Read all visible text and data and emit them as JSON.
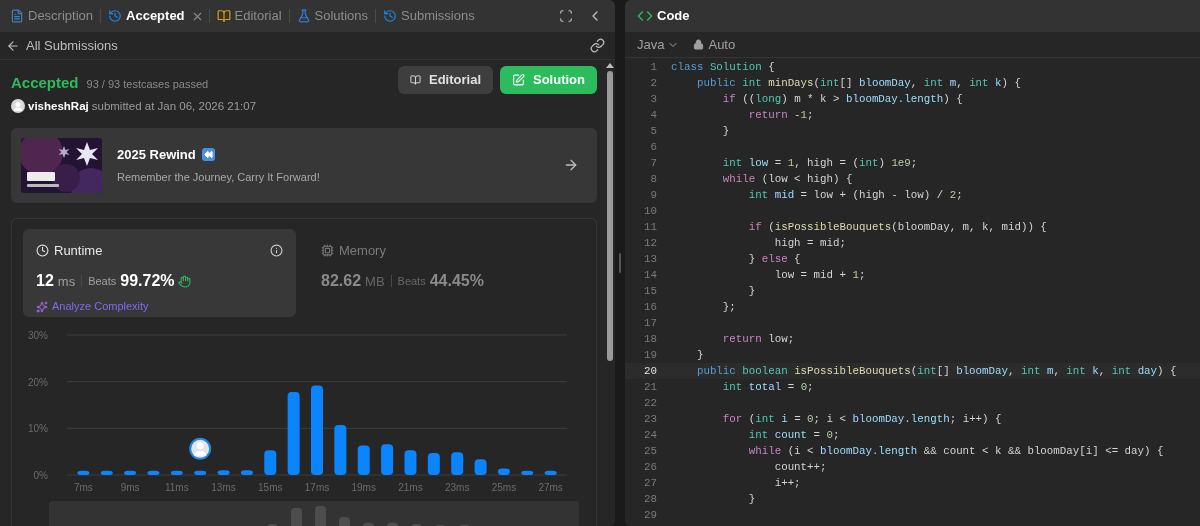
{
  "left_panel": {
    "tabs": [
      {
        "label": "Description",
        "kind": "description",
        "selected": false
      },
      {
        "label": "Accepted",
        "kind": "result",
        "selected": true,
        "closable": true
      },
      {
        "label": "Editorial",
        "kind": "editorial",
        "selected": false
      },
      {
        "label": "Solutions",
        "kind": "solutions",
        "selected": false
      },
      {
        "label": "Submissions",
        "kind": "submissions",
        "selected": false
      }
    ],
    "back_link": "All Submissions",
    "submission": {
      "status": "Accepted",
      "testcases": "93 / 93 testcases passed",
      "user": "visheshRaj",
      "submitted": "submitted at Jan 06, 2026 21:07"
    },
    "buttons": [
      {
        "label": "Editorial",
        "kind": "secondary"
      },
      {
        "label": "Solution",
        "kind": "primary"
      }
    ],
    "banner": {
      "title": "2025 Rewind",
      "subtitle": "Remember the Journey, Carry It Forward!"
    },
    "stats": [
      {
        "kind": "runtime",
        "title": "Runtime",
        "value": "12",
        "unit": "ms",
        "beats_label": "Beats",
        "beats": "99.72%",
        "selected": true,
        "link": "Analyze Complexity"
      },
      {
        "kind": "memory",
        "title": "Memory",
        "value": "82.62",
        "unit": "MB",
        "beats_label": "Beats",
        "beats": "44.45%",
        "selected": false
      }
    ],
    "chart_data": {
      "type": "bar",
      "x": [
        7,
        8,
        9,
        10,
        11,
        12,
        13,
        14,
        15,
        16,
        17,
        18,
        19,
        20,
        21,
        22,
        23,
        24,
        25,
        26,
        27
      ],
      "series": [
        {
          "color": "#0a84ff",
          "values": [
            0.9,
            0.9,
            0.9,
            0.9,
            0.9,
            0.9,
            1.0,
            1.0,
            5.3,
            17.8,
            19.2,
            10.7,
            6.3,
            6.6,
            5.3,
            4.7,
            4.9,
            3.4,
            1.4,
            0.9,
            0.9
          ]
        }
      ],
      "xlim": [
        6.3,
        27.7
      ],
      "ylim": [
        0,
        30
      ],
      "yticks": [
        {
          "value": 0,
          "label": "0%"
        },
        {
          "value": 10,
          "label": "10%"
        },
        {
          "value": 20,
          "label": "20%"
        },
        {
          "value": 30,
          "label": "30%"
        }
      ],
      "xticks": [
        {
          "value": 7,
          "label": "7ms"
        },
        {
          "value": 9,
          "label": "9ms"
        },
        {
          "value": 11,
          "label": "11ms"
        },
        {
          "value": 13,
          "label": "13ms"
        },
        {
          "value": 15,
          "label": "15ms"
        },
        {
          "value": 17,
          "label": "17ms"
        },
        {
          "value": 19,
          "label": "19ms"
        },
        {
          "value": 21,
          "label": "21ms"
        },
        {
          "value": 23,
          "label": "23ms"
        },
        {
          "value": 25,
          "label": "25ms"
        },
        {
          "value": 27,
          "label": "27ms"
        }
      ]
    }
  },
  "code_panel": {
    "title": "Code",
    "language": "Java",
    "mode": "Auto",
    "lines": [
      {
        "n": "1",
        "selected": false,
        "tokens": [
          {
            "kind": "kw",
            "text": "class "
          },
          {
            "kind": "type",
            "text": "Solution"
          },
          {
            "kind": "plain",
            "text": " {"
          }
        ]
      },
      {
        "n": "2",
        "selected": false,
        "tokens": [
          {
            "kind": "kw",
            "text": "    public "
          },
          {
            "kind": "type",
            "text": "int "
          },
          {
            "kind": "fn",
            "text": "minDays"
          },
          {
            "kind": "plain",
            "text": "("
          },
          {
            "kind": "type",
            "text": "int"
          },
          {
            "kind": "plain",
            "text": "[] "
          },
          {
            "kind": "var",
            "text": "bloomDay"
          },
          {
            "kind": "plain",
            "text": ", "
          },
          {
            "kind": "type",
            "text": "int "
          },
          {
            "kind": "var",
            "text": "m"
          },
          {
            "kind": "plain",
            "text": ", "
          },
          {
            "kind": "type",
            "text": "int "
          },
          {
            "kind": "var",
            "text": "k"
          },
          {
            "kind": "plain",
            "text": ") {"
          }
        ]
      },
      {
        "n": "3",
        "selected": false,
        "tokens": [
          {
            "kind": "ctrl",
            "text": "        if"
          },
          {
            "kind": "plain",
            "text": " (("
          },
          {
            "kind": "type",
            "text": "long"
          },
          {
            "kind": "plain",
            "text": ") m * k > "
          },
          {
            "kind": "var",
            "text": "bloomDay.length"
          },
          {
            "kind": "plain",
            "text": ") {"
          }
        ]
      },
      {
        "n": "4",
        "selected": false,
        "tokens": [
          {
            "kind": "ctrl",
            "text": "            return"
          },
          {
            "kind": "plain",
            "text": " -"
          },
          {
            "kind": "num",
            "text": "1"
          },
          {
            "kind": "plain",
            "text": ";"
          }
        ]
      },
      {
        "n": "5",
        "selected": false,
        "tokens": [
          {
            "kind": "plain",
            "text": "        }"
          }
        ]
      },
      {
        "n": "6",
        "selected": false
      },
      {
        "n": "7",
        "selected": false,
        "tokens": [
          {
            "kind": "type",
            "text": "        int "
          },
          {
            "kind": "var",
            "text": "low"
          },
          {
            "kind": "plain",
            "text": " = "
          },
          {
            "kind": "num",
            "text": "1"
          },
          {
            "kind": "plain",
            "text": ", high = ("
          },
          {
            "kind": "type",
            "text": "int"
          },
          {
            "kind": "plain",
            "text": ") "
          },
          {
            "kind": "num",
            "text": "1e9"
          },
          {
            "kind": "plain",
            "text": ";"
          }
        ]
      },
      {
        "n": "8",
        "selected": false,
        "tokens": [
          {
            "kind": "ctrl",
            "text": "        while"
          },
          {
            "kind": "plain",
            "text": " (low < high) {"
          }
        ]
      },
      {
        "n": "9",
        "selected": false,
        "tokens": [
          {
            "kind": "type",
            "text": "            int "
          },
          {
            "kind": "var",
            "text": "mid"
          },
          {
            "kind": "plain",
            "text": " = low + (high - low) / "
          },
          {
            "kind": "num",
            "text": "2"
          },
          {
            "kind": "plain",
            "text": ";"
          }
        ]
      },
      {
        "n": "10",
        "selected": false
      },
      {
        "n": "11",
        "selected": false,
        "tokens": [
          {
            "kind": "ctrl",
            "text": "            if"
          },
          {
            "kind": "plain",
            "text": " ("
          },
          {
            "kind": "fn",
            "text": "isPossibleBouquets"
          },
          {
            "kind": "plain",
            "text": "(bloomDay, m, k, mid)) {"
          }
        ]
      },
      {
        "n": "12",
        "selected": false,
        "tokens": [
          {
            "kind": "plain",
            "text": "                high = mid;"
          }
        ]
      },
      {
        "n": "13",
        "selected": false,
        "tokens": [
          {
            "kind": "plain",
            "text": "            } "
          },
          {
            "kind": "ctrl",
            "text": "else"
          },
          {
            "kind": "plain",
            "text": " {"
          }
        ]
      },
      {
        "n": "14",
        "selected": false,
        "tokens": [
          {
            "kind": "plain",
            "text": "                low = mid + "
          },
          {
            "kind": "num",
            "text": "1"
          },
          {
            "kind": "plain",
            "text": ";"
          }
        ]
      },
      {
        "n": "15",
        "selected": false,
        "tokens": [
          {
            "kind": "plain",
            "text": "            }"
          }
        ]
      },
      {
        "n": "16",
        "selected": false,
        "tokens": [
          {
            "kind": "plain",
            "text": "        };"
          }
        ]
      },
      {
        "n": "17",
        "selected": false
      },
      {
        "n": "18",
        "selected": false,
        "tokens": [
          {
            "kind": "ctrl",
            "text": "        return"
          },
          {
            "kind": "plain",
            "text": " low;"
          }
        ]
      },
      {
        "n": "19",
        "selected": false,
        "tokens": [
          {
            "kind": "plain",
            "text": "    }"
          }
        ]
      },
      {
        "n": "20",
        "selected": true,
        "tokens": [
          {
            "kind": "kw",
            "text": "    public "
          },
          {
            "kind": "type",
            "text": "boolean "
          },
          {
            "kind": "fn",
            "text": "isPossibleBouquets"
          },
          {
            "kind": "plain",
            "text": "("
          },
          {
            "kind": "type",
            "text": "int"
          },
          {
            "kind": "plain",
            "text": "[] "
          },
          {
            "kind": "var",
            "text": "bloomDay"
          },
          {
            "kind": "plain",
            "text": ", "
          },
          {
            "kind": "type",
            "text": "int "
          },
          {
            "kind": "var",
            "text": "m"
          },
          {
            "kind": "plain",
            "text": ", "
          },
          {
            "kind": "type",
            "text": "int "
          },
          {
            "kind": "var",
            "text": "k"
          },
          {
            "kind": "plain",
            "text": ", "
          },
          {
            "kind": "type",
            "text": "int "
          },
          {
            "kind": "var",
            "text": "day"
          },
          {
            "kind": "plain",
            "text": ") {"
          }
        ]
      },
      {
        "n": "21",
        "selected": false,
        "tokens": [
          {
            "kind": "type",
            "text": "        int "
          },
          {
            "kind": "var",
            "text": "total"
          },
          {
            "kind": "plain",
            "text": " = "
          },
          {
            "kind": "num",
            "text": "0"
          },
          {
            "kind": "plain",
            "text": ";"
          }
        ]
      },
      {
        "n": "22",
        "selected": false
      },
      {
        "n": "23",
        "selected": false,
        "tokens": [
          {
            "kind": "ctrl",
            "text": "        for"
          },
          {
            "kind": "plain",
            "text": " ("
          },
          {
            "kind": "type",
            "text": "int "
          },
          {
            "kind": "var",
            "text": "i"
          },
          {
            "kind": "plain",
            "text": " = "
          },
          {
            "kind": "num",
            "text": "0"
          },
          {
            "kind": "plain",
            "text": "; i < "
          },
          {
            "kind": "var",
            "text": "bloomDay.length"
          },
          {
            "kind": "plain",
            "text": "; i++) {"
          }
        ]
      },
      {
        "n": "24",
        "selected": false,
        "tokens": [
          {
            "kind": "type",
            "text": "            int "
          },
          {
            "kind": "var",
            "text": "count"
          },
          {
            "kind": "plain",
            "text": " = "
          },
          {
            "kind": "num",
            "text": "0"
          },
          {
            "kind": "plain",
            "text": ";"
          }
        ]
      },
      {
        "n": "25",
        "selected": false,
        "tokens": [
          {
            "kind": "ctrl",
            "text": "            while"
          },
          {
            "kind": "plain",
            "text": " (i < "
          },
          {
            "kind": "var",
            "text": "bloomDay.length"
          },
          {
            "kind": "plain",
            "text": " && count < k && bloomDay[i] <= day) {"
          }
        ]
      },
      {
        "n": "26",
        "selected": false,
        "tokens": [
          {
            "kind": "plain",
            "text": "                count++;"
          }
        ]
      },
      {
        "n": "27",
        "selected": false,
        "tokens": [
          {
            "kind": "plain",
            "text": "                i++;"
          }
        ]
      },
      {
        "n": "28",
        "selected": false,
        "tokens": [
          {
            "kind": "plain",
            "text": "            }"
          }
        ]
      },
      {
        "n": "29",
        "selected": false
      }
    ]
  }
}
